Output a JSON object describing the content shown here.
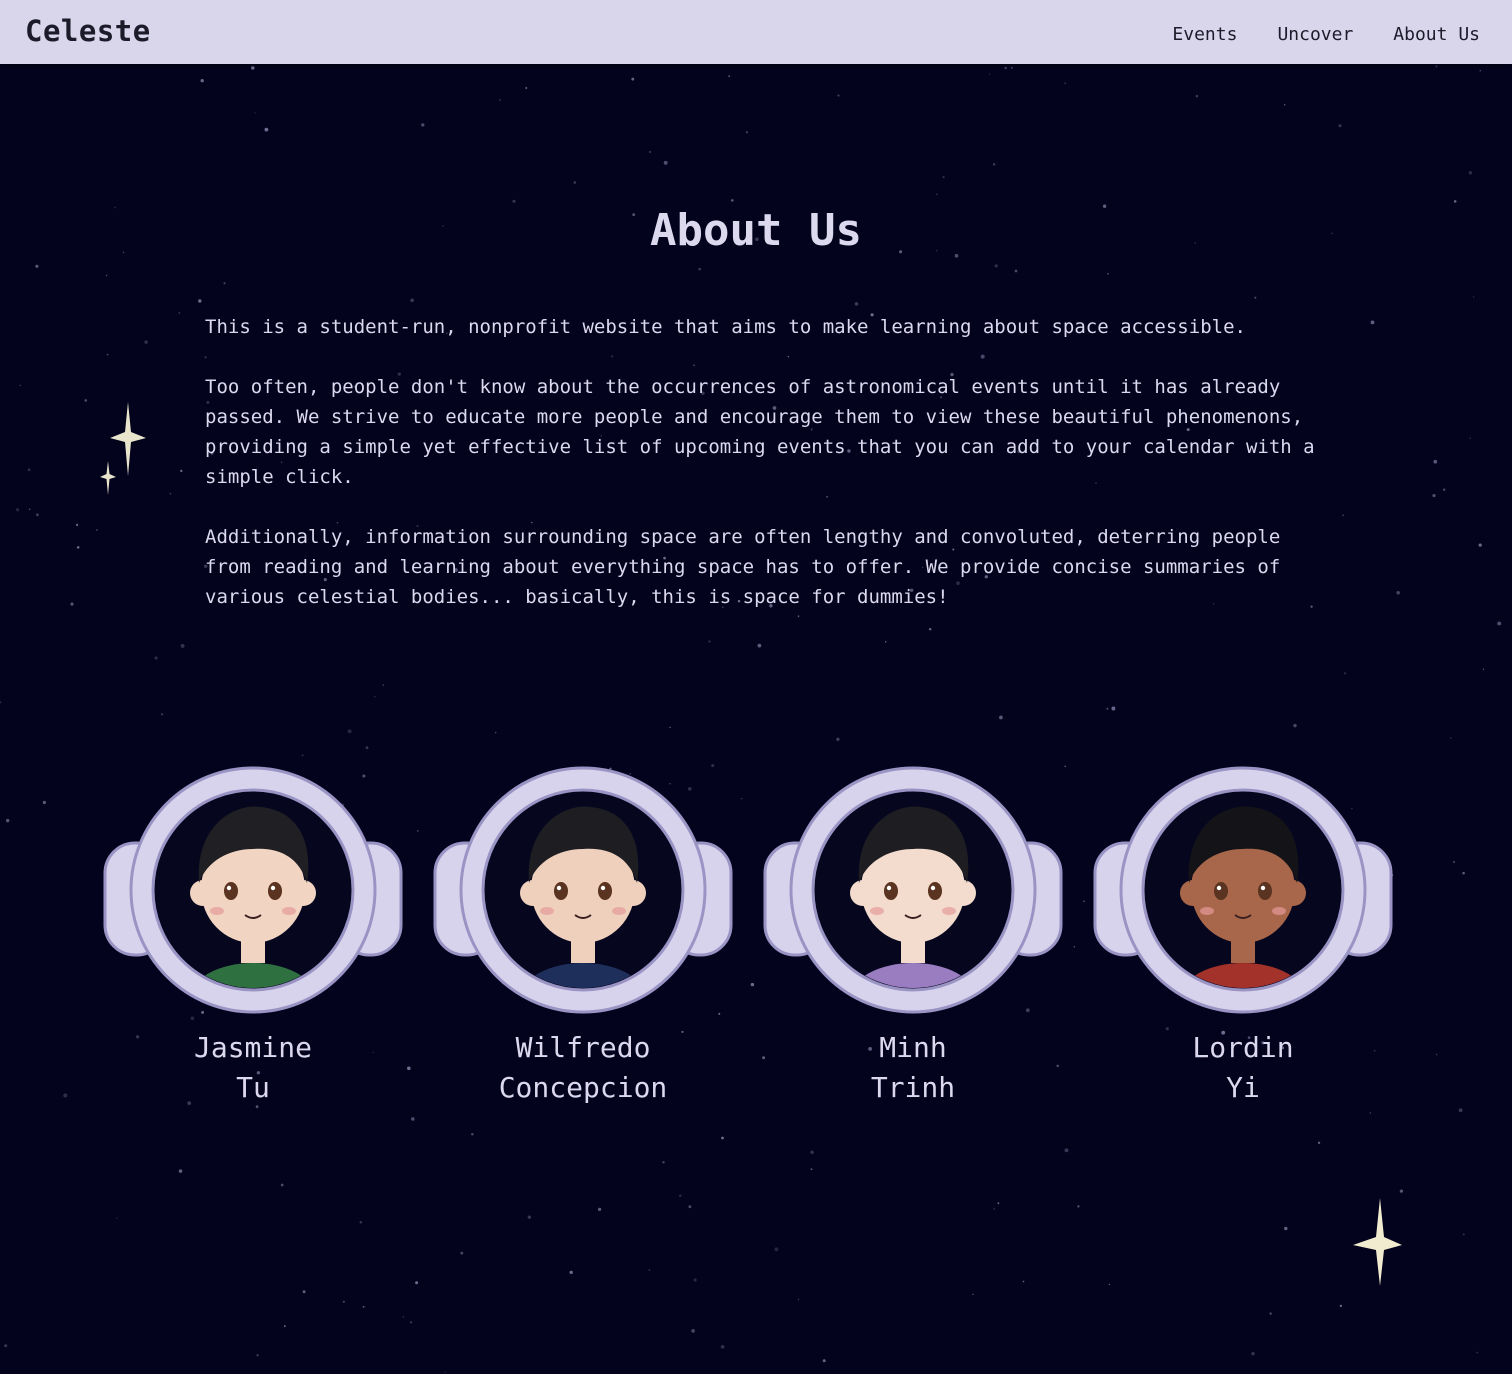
{
  "header": {
    "brand": "Celeste",
    "nav": [
      {
        "label": "Events"
      },
      {
        "label": "Uncover"
      },
      {
        "label": "About Us"
      }
    ]
  },
  "main": {
    "title": "About Us",
    "paragraphs": [
      "This is a student-run, nonprofit website that aims to make learning about space accessible.",
      "Too often, people don't know about the occurrences of astronomical events until it has already passed. We strive to educate more people and encourage them to view these beautiful phenomenons, providing a simple yet effective list of upcoming events that you can add to your calendar with a simple click.",
      "Additionally, information surrounding space are often lengthy and convoluted, deterring people from reading and learning about everything space has to offer. We provide concise summaries of various celestial bodies... basically, this is space for dummies!"
    ]
  },
  "team": [
    {
      "first": "Jasmine",
      "last": "Tu",
      "shirt": "#2f7040",
      "skin": "#f1d4c2",
      "hair": "#1f1f24"
    },
    {
      "first": "Wilfredo",
      "last": "Concepcion",
      "shirt": "#1f2f5c",
      "skin": "#efd0bd",
      "hair": "#1d1d22"
    },
    {
      "first": "Minh",
      "last": "Trinh",
      "shirt": "#9a7cc0",
      "skin": "#f3dcce",
      "hair": "#1d1d22"
    },
    {
      "first": "Lordin",
      "last": "Yi",
      "shirt": "#a3322b",
      "skin": "#a8674a",
      "hair": "#141418"
    }
  ],
  "colors": {
    "background": "#04031e",
    "navbar": "#d9d6ec",
    "text": "#dcd9ee",
    "helmet": "#d8d3ec"
  }
}
